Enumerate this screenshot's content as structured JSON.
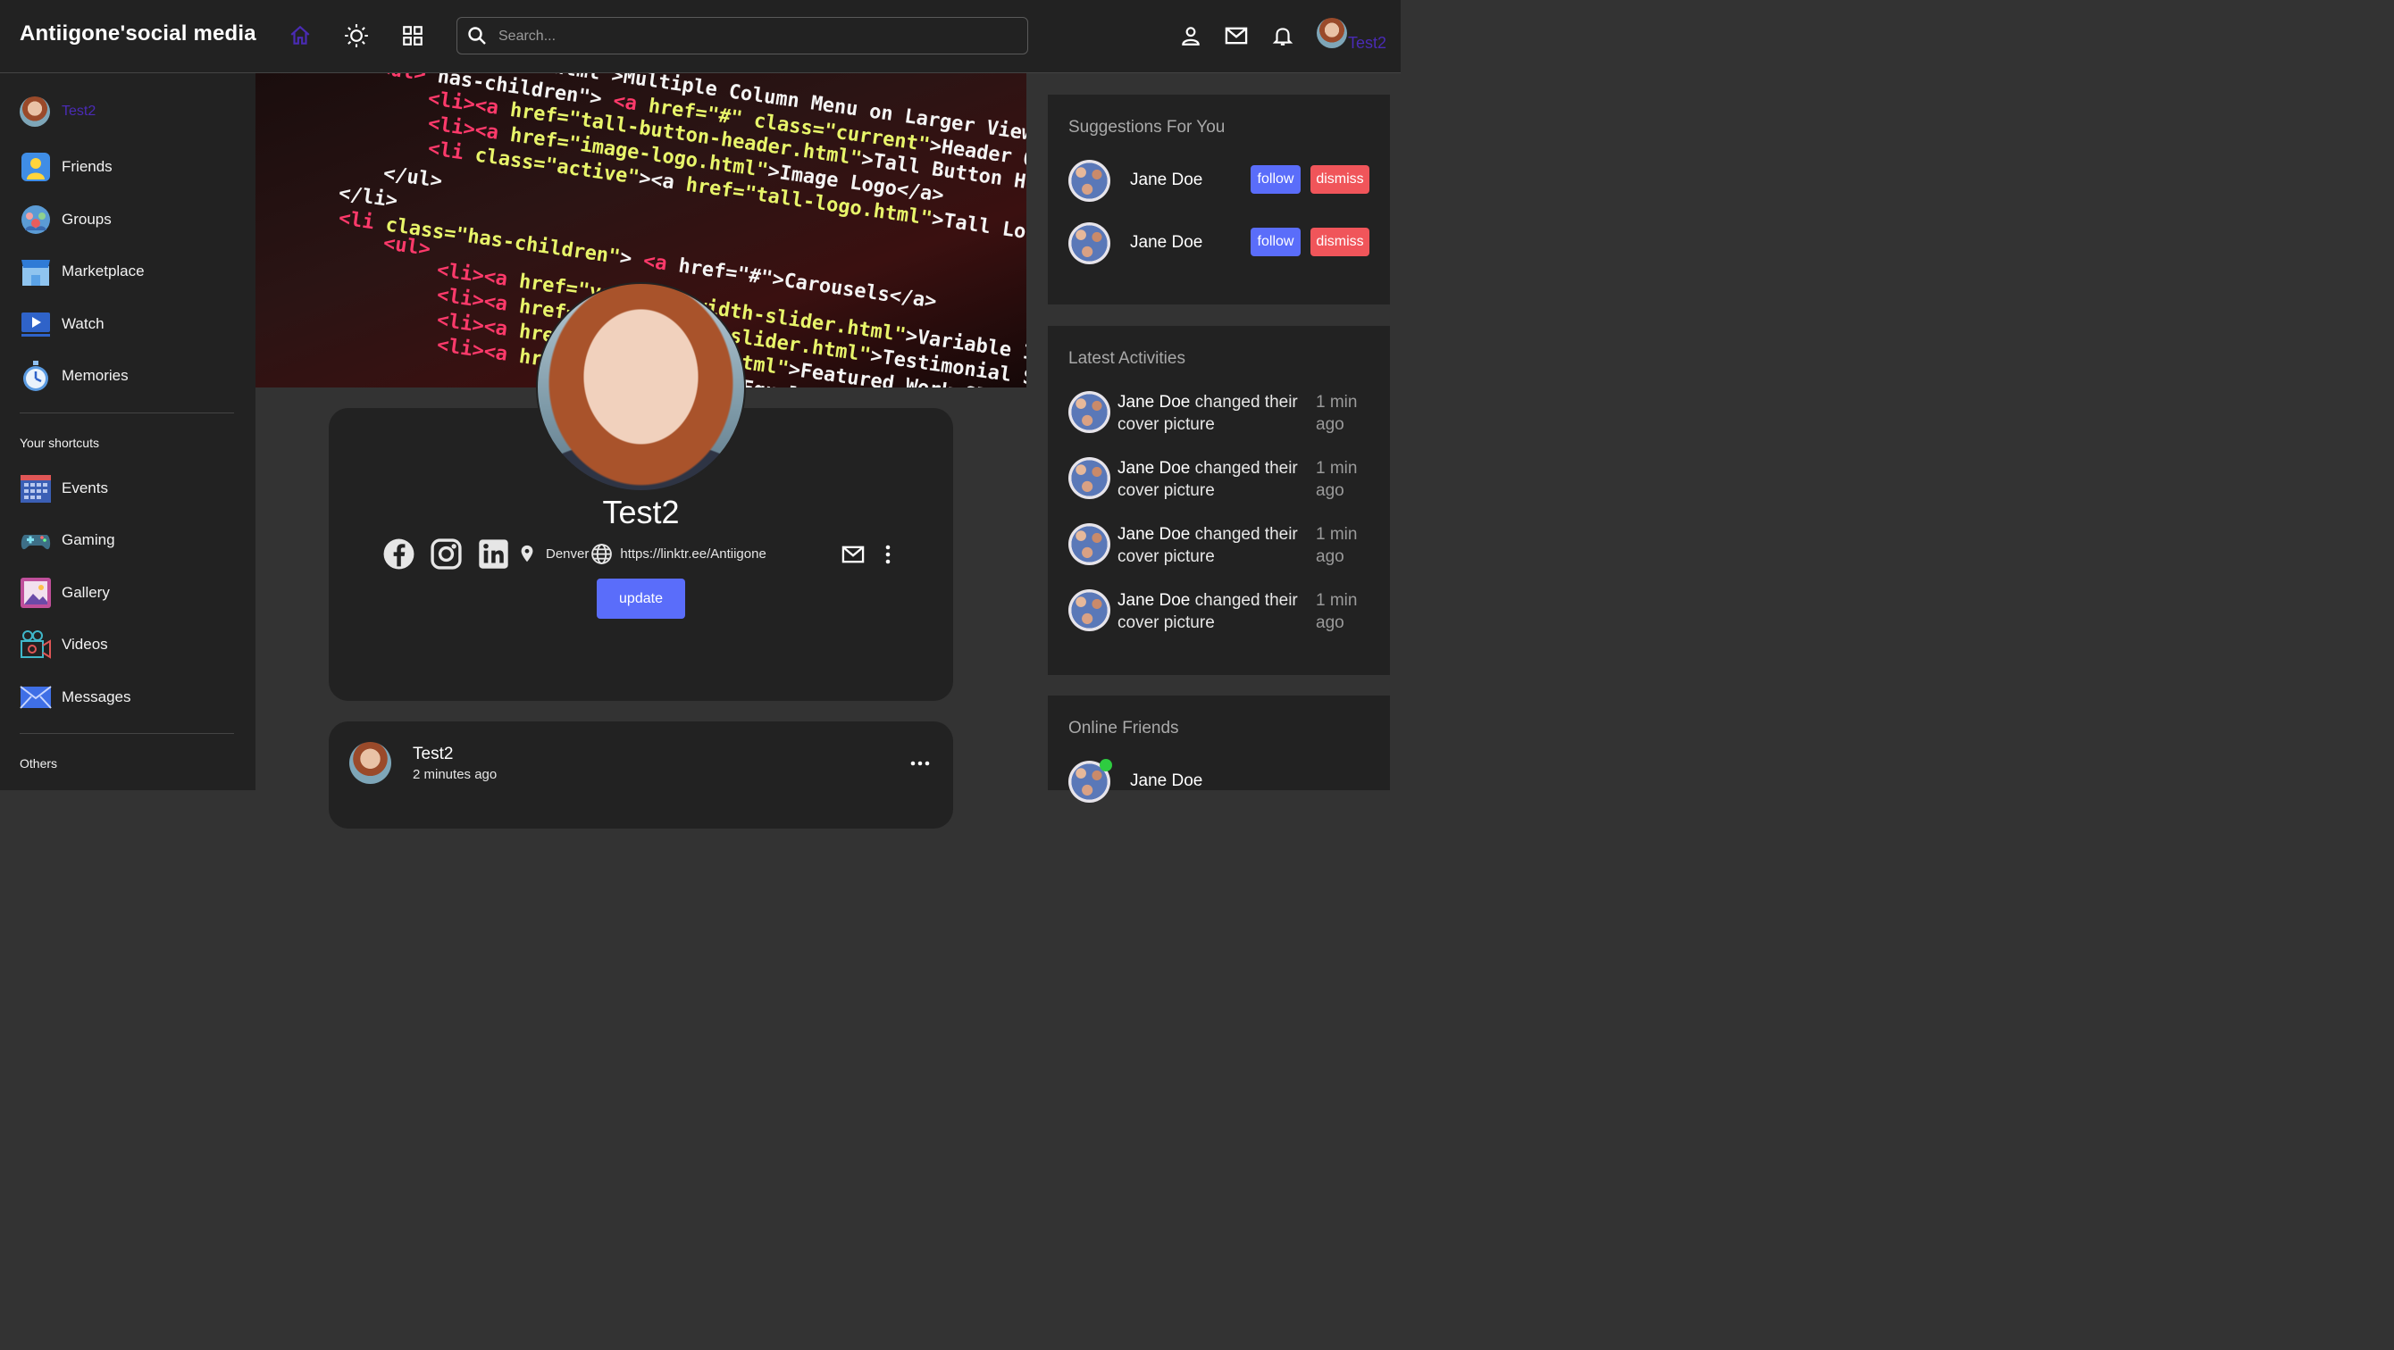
{
  "navbar": {
    "brand": "Antiigone'social media",
    "search_placeholder": "Search...",
    "user_name": "Test2",
    "accent_color": "#4a2bb5"
  },
  "left_sidebar": {
    "user_name": "Test2",
    "menu": [
      {
        "label": "Friends",
        "icon": "friends-icon"
      },
      {
        "label": "Groups",
        "icon": "groups-icon"
      },
      {
        "label": "Marketplace",
        "icon": "marketplace-icon"
      },
      {
        "label": "Watch",
        "icon": "watch-icon"
      },
      {
        "label": "Memories",
        "icon": "memories-icon"
      }
    ],
    "shortcuts_title": "Your shortcuts",
    "shortcuts": [
      {
        "label": "Events",
        "icon": "events-icon"
      },
      {
        "label": "Gaming",
        "icon": "gaming-icon"
      },
      {
        "label": "Gallery",
        "icon": "gallery-icon"
      },
      {
        "label": "Videos",
        "icon": "videos-icon"
      },
      {
        "label": "Messages",
        "icon": "messages-icon"
      }
    ],
    "others_title": "Others"
  },
  "profile": {
    "name": "Test2",
    "location": "Denver",
    "website": "https://linktr.ee/Antiigone",
    "update_label": "update"
  },
  "post": {
    "author": "Test2",
    "time": "2 minutes ago"
  },
  "right_sidebar": {
    "suggestions_title": "Suggestions For You",
    "suggestions": [
      {
        "name": "Jane Doe",
        "follow_label": "follow",
        "dismiss_label": "dismiss"
      },
      {
        "name": "Jane Doe",
        "follow_label": "follow",
        "dismiss_label": "dismiss"
      }
    ],
    "activities_title": "Latest Activities",
    "activities": [
      {
        "name": "Jane Doe",
        "action": " changed their cover picture",
        "time": "1 min ago"
      },
      {
        "name": "Jane Doe",
        "action": " changed their cover picture",
        "time": "1 min ago"
      },
      {
        "name": "Jane Doe",
        "action": " changed their cover picture",
        "time": "1 min ago"
      },
      {
        "name": "Jane Doe",
        "action": " changed their cover picture",
        "time": "1 min ago"
      }
    ],
    "online_title": "Online Friends",
    "online": [
      {
        "name": "Jane Doe",
        "status_color": "#2ecc40"
      }
    ]
  },
  "colors": {
    "primary_button": "#5a6dfa",
    "danger_button": "#f0555a",
    "panel": "#222222",
    "background": "#333333"
  }
}
